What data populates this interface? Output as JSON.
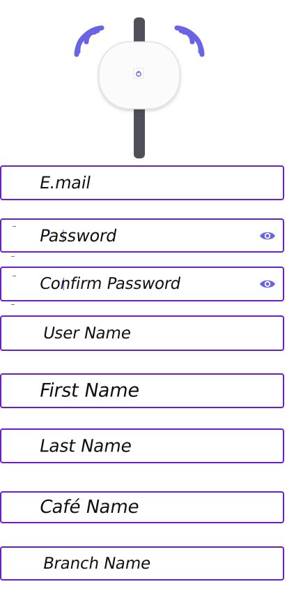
{
  "colors": {
    "accent": "#6a1ed0",
    "icon": "#6b63e6",
    "pole": "#4f505a",
    "text": "#111111"
  },
  "header": {
    "illustration_icon": "router-wifi-illustration"
  },
  "form": {
    "email": {
      "placeholder": "E.mail"
    },
    "password": {
      "placeholder": "Password",
      "toggle_icon": "eye-icon"
    },
    "confirm_password": {
      "placeholder": "Confirm Password",
      "toggle_icon": "eye-icon"
    },
    "user_name": {
      "placeholder": "User Name"
    },
    "first_name": {
      "placeholder": "First Name"
    },
    "last_name": {
      "placeholder": "Last Name"
    },
    "cafe_name": {
      "placeholder": "Café Name"
    },
    "branch_name": {
      "placeholder": "Branch Name"
    }
  }
}
